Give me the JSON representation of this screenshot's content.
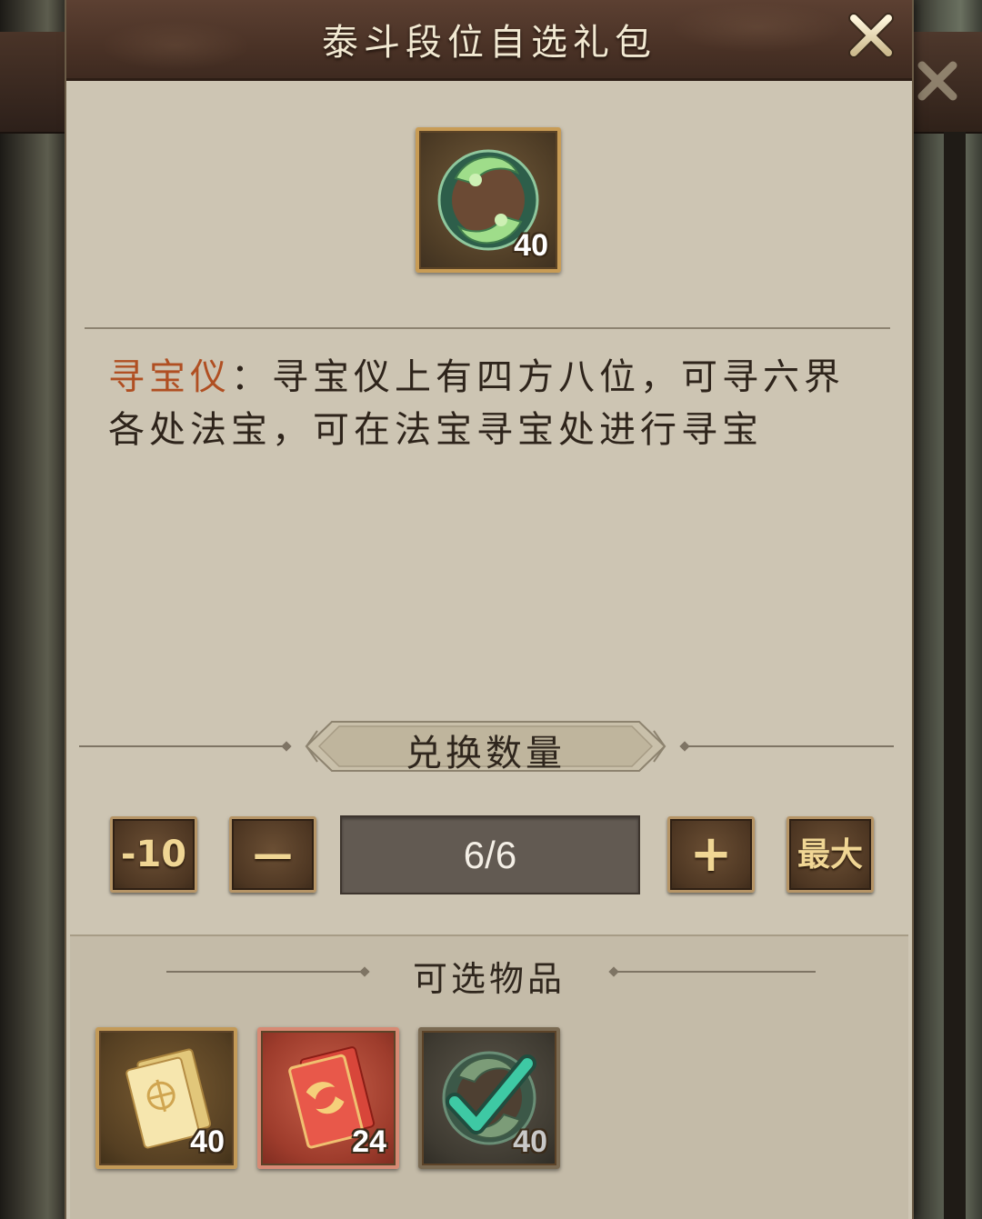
{
  "dialog": {
    "title": "泰斗段位自选礼包",
    "close_icon": "close-icon"
  },
  "selected_item": {
    "icon": "treasure-compass-icon",
    "count": "40",
    "name": "寻宝仪",
    "separator": "：",
    "description": "寻宝仪上有四方八位，可寻六界各处法宝，可在法宝寻宝处进行寻宝"
  },
  "quantity": {
    "label": "兑换数量",
    "minus_ten_label": "-10",
    "minus_label": "—",
    "value": "6/6",
    "plus_label": "+",
    "max_label": "最大"
  },
  "options": {
    "label": "可选物品",
    "items": [
      {
        "icon": "gold-talisman-icon",
        "count": "40"
      },
      {
        "icon": "red-talisman-icon",
        "count": "24"
      },
      {
        "icon": "treasure-compass-icon",
        "count": "40",
        "selected": true
      }
    ]
  },
  "colors": {
    "header": "#4a3226",
    "panel": "#cdc5b3",
    "highlight_name": "#b04f22",
    "button_gold": "#f0d694"
  }
}
